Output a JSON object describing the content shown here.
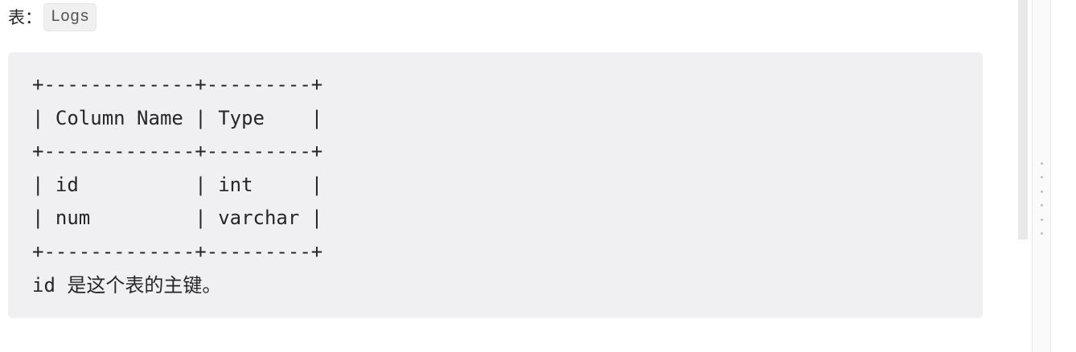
{
  "table_label": {
    "prefix": "表：",
    "name": "Logs"
  },
  "code_block": {
    "lines": [
      "+-------------+---------+",
      "| Column Name | Type    |",
      "+-------------+---------+",
      "| id          | int     |",
      "| num         | varchar |",
      "+-------------+---------+",
      "id 是这个表的主键。"
    ]
  },
  "colors": {
    "code_block_bg": "#f0f0f2",
    "inline_code_bg": "#f0f0f0",
    "text": "#262626"
  },
  "icons": {
    "panel_handle": "drag-handle-icon"
  }
}
